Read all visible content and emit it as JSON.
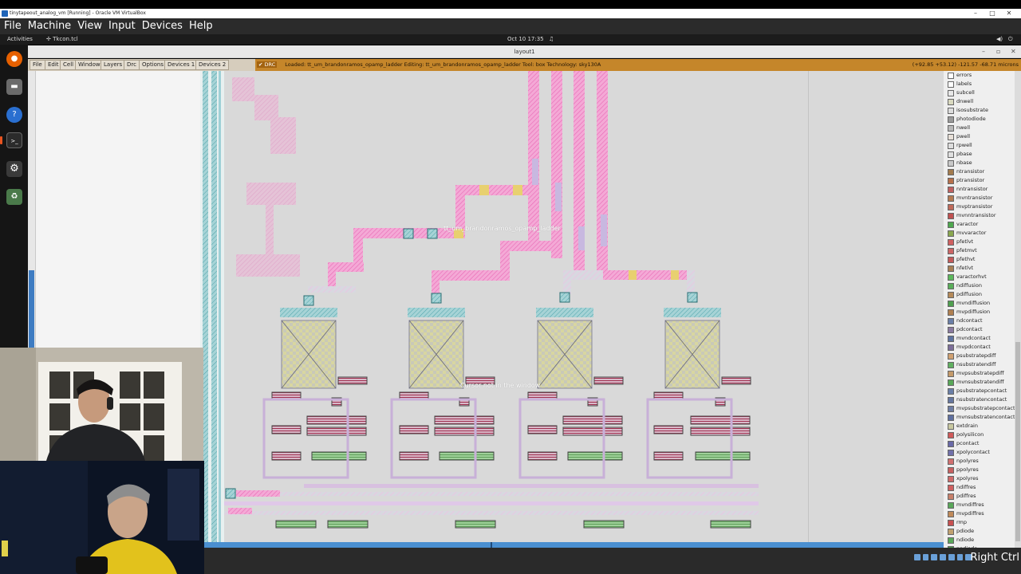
{
  "vbox": {
    "window_title": "tinytapeout_analog_vm [Running] - Oracle VM VirtualBox",
    "menu": [
      "File",
      "Machine",
      "View",
      "Input",
      "Devices",
      "Help"
    ],
    "host_key": "Right Ctrl"
  },
  "gnome": {
    "activities": "Activities",
    "app_name": "Tkcon.tcl",
    "clock": "Oct 10  17:35"
  },
  "magic": {
    "window_title": "layout1",
    "menus": [
      "File",
      "Edit",
      "Cell",
      "Window",
      "Layers",
      "Drc",
      "Options",
      "Devices 1",
      "Devices 2"
    ],
    "drc_label": "DRC",
    "status": "Loaded: tt_um_brandonramos_opamp_ladder  Editing: tt_um_brandonramos_opamp_ladder  Tool: box   Technology: sky130A",
    "coords": "(+92.85 +53.12) -121.57 -68.71 microns",
    "cell_label": "tt_um_brandonramos_opamp_ladder",
    "hint_label": "Cursor not in the window"
  },
  "layers": [
    {
      "name": "errors",
      "color": "#ffffff"
    },
    {
      "name": "labels",
      "color": "#ffffff"
    },
    {
      "name": "subcell",
      "color": "#e8e8e8"
    },
    {
      "name": "dnwell",
      "color": "#d9d9bf"
    },
    {
      "name": "isosubstrate",
      "color": "#dddddd"
    },
    {
      "name": "photodiode",
      "color": "#9a9a9a"
    },
    {
      "name": "nwell",
      "color": "#b8b8b8"
    },
    {
      "name": "pwell",
      "color": "#e8e0d8"
    },
    {
      "name": "rpwell",
      "color": "#dedede"
    },
    {
      "name": "pbase",
      "color": "#e0e0e0"
    },
    {
      "name": "nbase",
      "color": "#c8c8c8"
    },
    {
      "name": "ntransistor",
      "color": "#a37b4d"
    },
    {
      "name": "ptransistor",
      "color": "#b7704b"
    },
    {
      "name": "nntransistor",
      "color": "#c06060"
    },
    {
      "name": "mvntransistor",
      "color": "#b57b52"
    },
    {
      "name": "mvptransistor",
      "color": "#c06a5a"
    },
    {
      "name": "mvnntransistor",
      "color": "#c05050"
    },
    {
      "name": "varactor",
      "color": "#4ea84e"
    },
    {
      "name": "mvvaractor",
      "color": "#8aa850"
    },
    {
      "name": "pfetlvt",
      "color": "#d06060"
    },
    {
      "name": "pfetmvt",
      "color": "#cc6666"
    },
    {
      "name": "pfethvt",
      "color": "#c45a5a"
    },
    {
      "name": "nfetlvt",
      "color": "#a88055"
    },
    {
      "name": "varactorhvt",
      "color": "#5cb85c"
    },
    {
      "name": "ndiffusion",
      "color": "#5aae5a"
    },
    {
      "name": "pdiffusion",
      "color": "#b58a5a"
    },
    {
      "name": "mvndiffusion",
      "color": "#50a050"
    },
    {
      "name": "mvpdiffusion",
      "color": "#b08050"
    },
    {
      "name": "ndcontact",
      "color": "#6a7fa8"
    },
    {
      "name": "pdcontact",
      "color": "#8a7aa0"
    },
    {
      "name": "mvndcontact",
      "color": "#5f74a0"
    },
    {
      "name": "mvpdcontact",
      "color": "#7d6f9a"
    },
    {
      "name": "psubstratepdiff",
      "color": "#d0a070"
    },
    {
      "name": "nsubstratendiff",
      "color": "#60b060"
    },
    {
      "name": "mvpsubstratepdiff",
      "color": "#c49a6a"
    },
    {
      "name": "mvnsubstratendiff",
      "color": "#58a858"
    },
    {
      "name": "psubstratepcontact",
      "color": "#6a7fa8"
    },
    {
      "name": "nsubstratencontact",
      "color": "#6677a0"
    },
    {
      "name": "mvpsubstratepcontact",
      "color": "#6f7ea4"
    },
    {
      "name": "mvnsubstratencontact",
      "color": "#5f70a0"
    },
    {
      "name": "extdrain",
      "color": "#c8c8a0"
    },
    {
      "name": "polysilicon",
      "color": "#d05a5a"
    },
    {
      "name": "pcontact",
      "color": "#6a6aa8"
    },
    {
      "name": "xpolycontact",
      "color": "#7070aa"
    },
    {
      "name": "npolyres",
      "color": "#d07070"
    },
    {
      "name": "ppolyres",
      "color": "#c86060"
    },
    {
      "name": "xpolyres",
      "color": "#d06a6a"
    },
    {
      "name": "ndiffres",
      "color": "#d06060"
    },
    {
      "name": "pdiffres",
      "color": "#c8806a"
    },
    {
      "name": "mvndiffres",
      "color": "#5aa85a"
    },
    {
      "name": "mvpdiffres",
      "color": "#c08a5a"
    },
    {
      "name": "rmp",
      "color": "#c85050"
    },
    {
      "name": "pdiode",
      "color": "#c0a070"
    },
    {
      "name": "ndiode",
      "color": "#5aa85a"
    },
    {
      "name": "nndiode",
      "color": "#4ea04e"
    }
  ]
}
